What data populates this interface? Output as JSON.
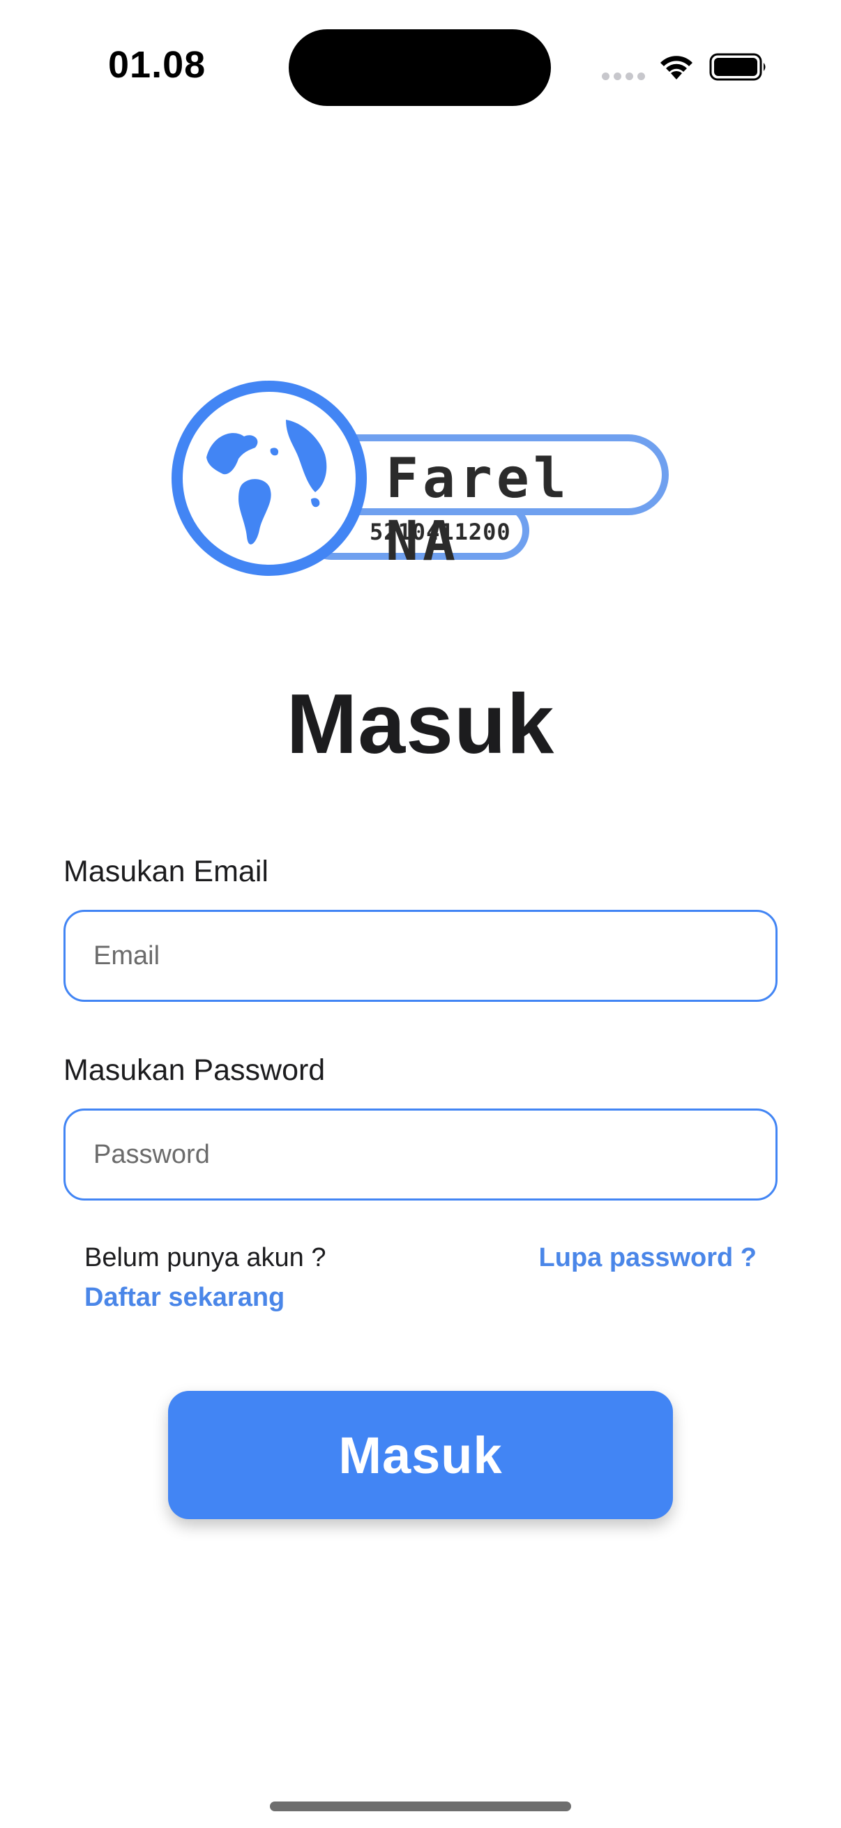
{
  "status_bar": {
    "time": "01.08"
  },
  "logo": {
    "name": "Farel NA",
    "id_number": "5210411200",
    "primary_color": "#4285f4",
    "secondary_color": "#6fa0ef"
  },
  "title": "Masuk",
  "form": {
    "email_label": "Masukan Email",
    "email_placeholder": "Email",
    "email_value": "",
    "password_label": "Masukan Password",
    "password_placeholder": "Password",
    "password_value": ""
  },
  "links": {
    "no_account_text": "Belum punya akun ?",
    "register_label": "Daftar sekarang",
    "forgot_password_label": "Lupa password ?"
  },
  "login_button_label": "Masuk",
  "colors": {
    "accent": "#4285f4",
    "link": "#4a86e8",
    "text": "#1c1c1e"
  }
}
